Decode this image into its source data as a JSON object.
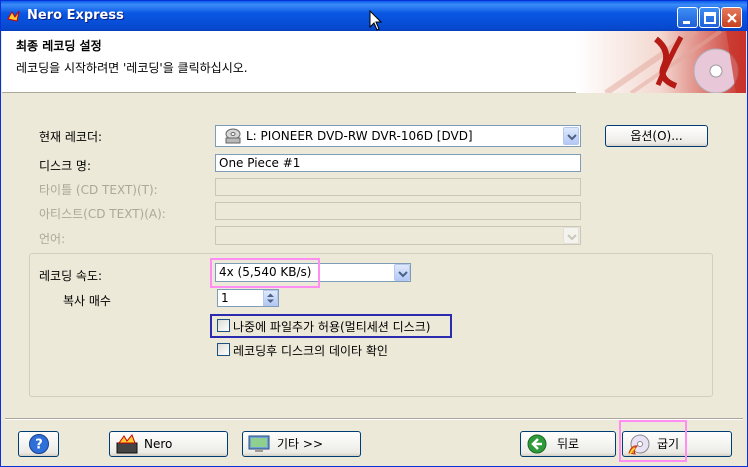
{
  "window": {
    "title": "Nero Express"
  },
  "header": {
    "title": "최종 레코딩 설정",
    "subtitle": "레코딩을 시작하려면 '레코딩'을 클릭하십시오."
  },
  "form": {
    "recorder_label": "현재 레코더:",
    "recorder_value": "L: PIONEER  DVD-RW  DVR-106D   [DVD]",
    "options_button": "옵션(O)...",
    "disc_name_label": "디스크 명:",
    "disc_name_value": "One Piece #1",
    "cd_text_title_label": "타이틀 (CD TEXT)(T):",
    "cd_text_artist_label": "아티스트(CD TEXT)(A):",
    "language_label": "언어:"
  },
  "speed": {
    "label": "레코딩 속도:",
    "value": "4x (5,540 KB/s)",
    "copies_label": "복사 매수",
    "copies_value": "1",
    "multisession_label": "나중에 파일추가 허용(멀티세션 디스크)",
    "multisession_checked": false,
    "verify_label": "레코딩후 디스크의 데이타 확인",
    "verify_checked": false
  },
  "footer": {
    "help_button": "?",
    "nero_button": "Nero",
    "more_button": "기타 >>",
    "back_button": "뒤로",
    "burn_button": "굽기"
  },
  "colors": {
    "titlebar": "#0a58e4",
    "highlight_pink": "#ff8df2",
    "highlight_blue": "#2b2bb0"
  }
}
